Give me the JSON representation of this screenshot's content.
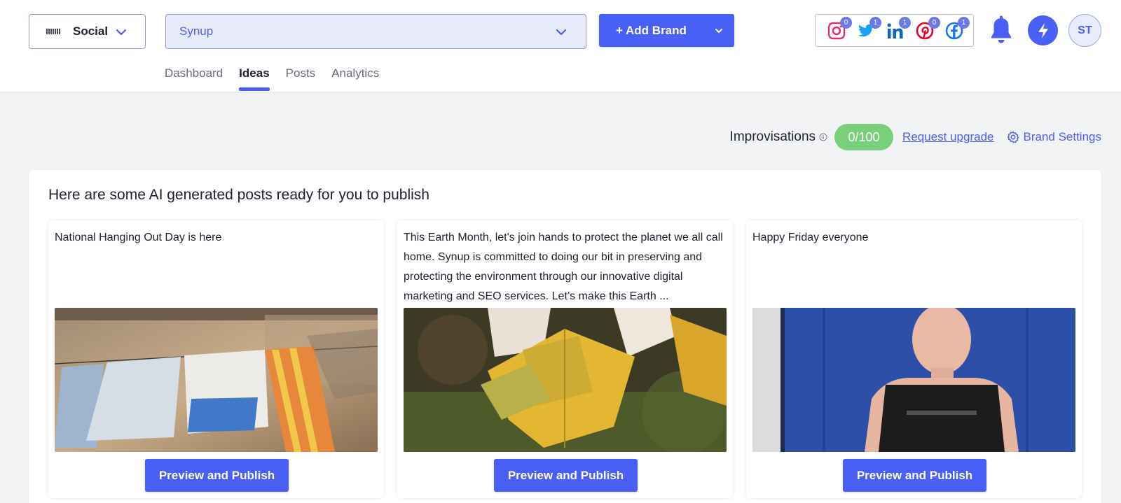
{
  "header": {
    "product_switcher": {
      "label": "Social"
    },
    "brand_select": {
      "value": "Synup"
    },
    "add_brand_label": "+ Add Brand",
    "social_accounts": [
      {
        "network": "instagram",
        "icon": "instagram-icon",
        "count": "0",
        "color": "#e1306c"
      },
      {
        "network": "twitter",
        "icon": "twitter-icon",
        "count": "1",
        "color": "#1da1f2"
      },
      {
        "network": "linkedin",
        "icon": "linkedin-icon",
        "count": "1",
        "color": "#0a66c2"
      },
      {
        "network": "pinterest",
        "icon": "pinterest-icon",
        "count": "0",
        "color": "#e60023"
      },
      {
        "network": "facebook",
        "icon": "facebook-icon",
        "count": "1",
        "color": "#1877f2"
      }
    ],
    "avatar_initials": "ST"
  },
  "tabs": [
    {
      "label": "Dashboard",
      "active": false
    },
    {
      "label": "Ideas",
      "active": true
    },
    {
      "label": "Posts",
      "active": false
    },
    {
      "label": "Analytics",
      "active": false
    }
  ],
  "improvisations": {
    "label": "Improvisations",
    "value": "0/100",
    "upgrade_link": "Request upgrade",
    "settings_link": "Brand Settings"
  },
  "ideas": {
    "title": "Here are some AI generated posts ready for you to publish",
    "cards": [
      {
        "caption": "National Hanging Out Day is here",
        "image": "laundry-hanging-photo",
        "button": "Preview and Publish"
      },
      {
        "caption": "This Earth Month, let's join hands to protect the planet we all call home. Synup is committed to doing our bit in preserving and protecting the environment through our innovative digital marketing and SEO services. Let’s make this Earth ...",
        "image": "autumn-leaves-photo",
        "button": "Preview and Publish"
      },
      {
        "caption": "Happy Friday everyone",
        "image": "man-dancing-photo",
        "button": "Preview and Publish"
      }
    ]
  },
  "colors": {
    "accent": "#4a5ff5",
    "improvisations_pill": "#78d07a",
    "background": "#f2f3f5"
  }
}
